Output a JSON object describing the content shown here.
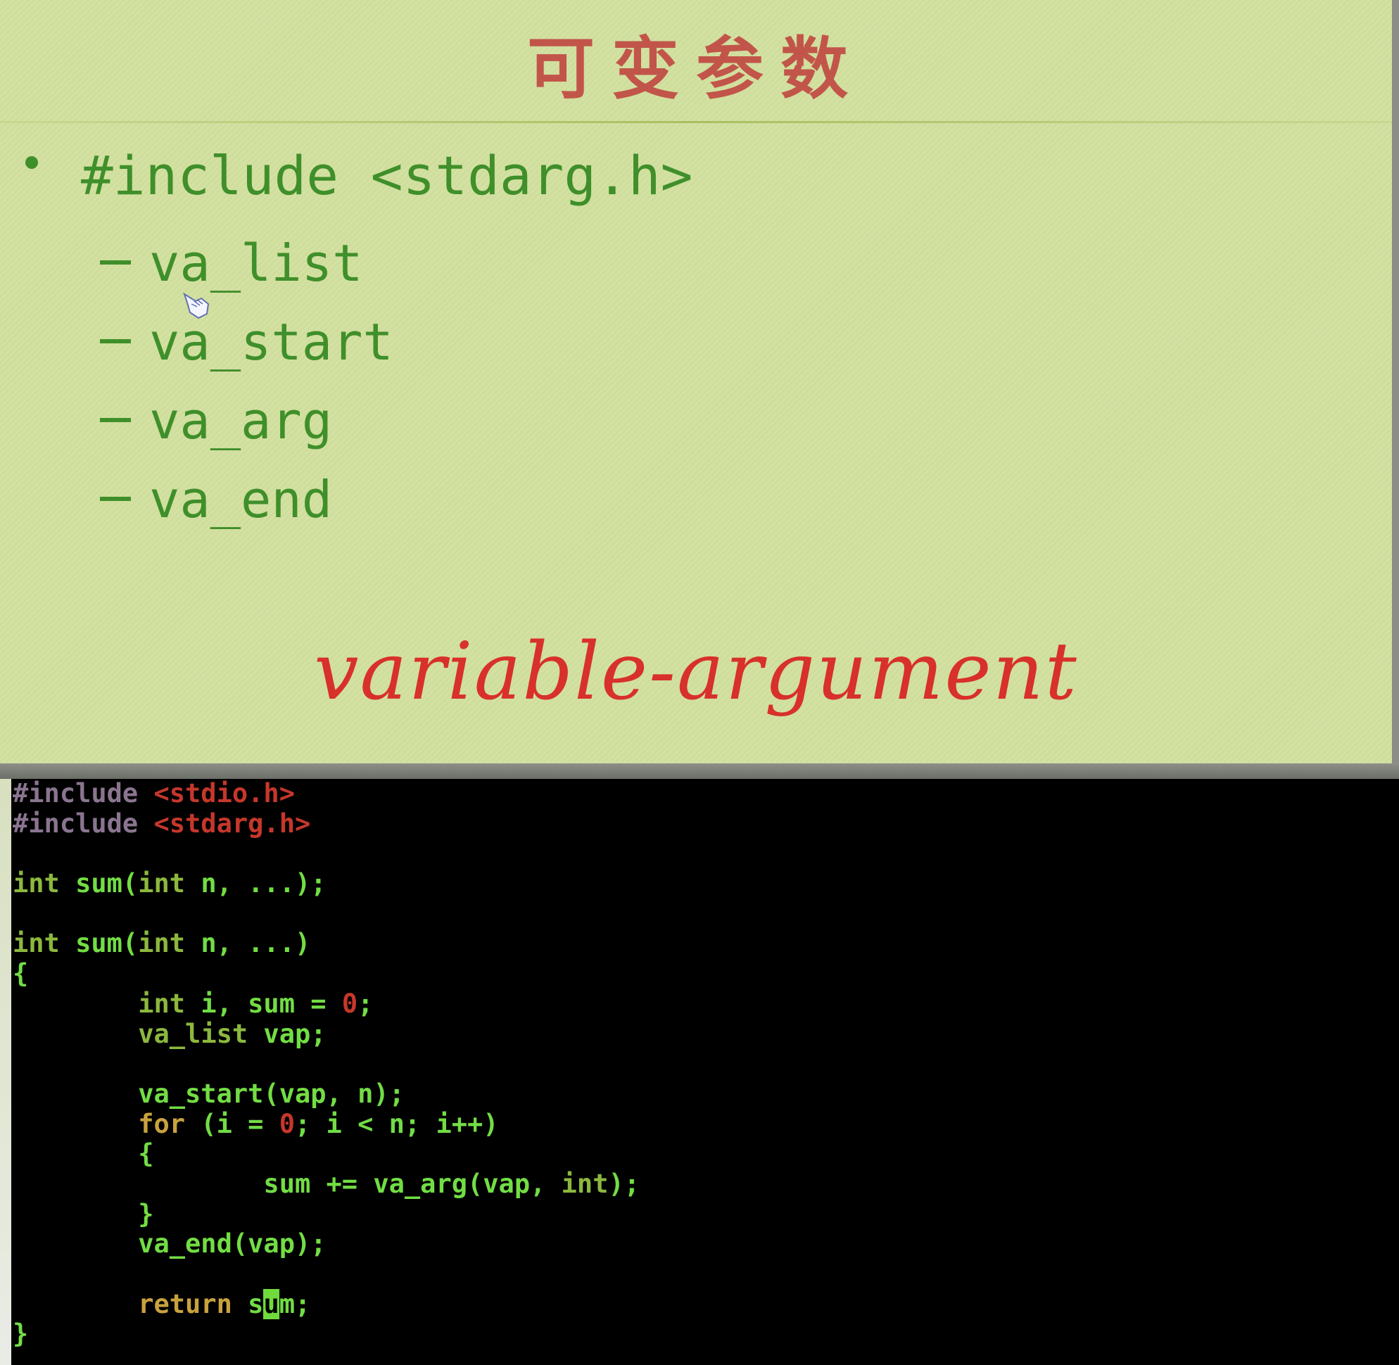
{
  "slide": {
    "title": "可变参数",
    "bullet": "#include <stdarg.h>",
    "sub_items": [
      "va_list",
      "va_start",
      "va_arg",
      "va_end"
    ],
    "handwritten_note": "variable-argument"
  },
  "colors": {
    "preproc": "#8a7590",
    "string": "#c6372b",
    "type": "#8cb83e",
    "ident": "#72dd44",
    "keyword": "#c9a23e",
    "number": "#c6372b"
  },
  "code": {
    "lines": [
      [
        {
          "t": "#include ",
          "c": "preproc"
        },
        {
          "t": "<stdio.h>",
          "c": "string"
        }
      ],
      [
        {
          "t": "#include ",
          "c": "preproc"
        },
        {
          "t": "<stdarg.h>",
          "c": "string"
        }
      ],
      [],
      [
        {
          "t": "int",
          "c": "type"
        },
        {
          "t": " sum(",
          "c": "ident"
        },
        {
          "t": "int",
          "c": "type"
        },
        {
          "t": " n, ...);",
          "c": "ident"
        }
      ],
      [],
      [
        {
          "t": "int",
          "c": "type"
        },
        {
          "t": " sum(",
          "c": "ident"
        },
        {
          "t": "int",
          "c": "type"
        },
        {
          "t": " n, ...)",
          "c": "ident"
        }
      ],
      [
        {
          "t": "{",
          "c": "ident"
        }
      ],
      [
        {
          "t": "        "
        },
        {
          "t": "int",
          "c": "type"
        },
        {
          "t": " i, sum = ",
          "c": "ident"
        },
        {
          "t": "0",
          "c": "number"
        },
        {
          "t": ";",
          "c": "ident"
        }
      ],
      [
        {
          "t": "        "
        },
        {
          "t": "va_list",
          "c": "type"
        },
        {
          "t": " vap;",
          "c": "ident"
        }
      ],
      [],
      [
        {
          "t": "        va_start(vap, n);",
          "c": "ident"
        }
      ],
      [
        {
          "t": "        "
        },
        {
          "t": "for",
          "c": "keyword"
        },
        {
          "t": " (i = ",
          "c": "ident"
        },
        {
          "t": "0",
          "c": "number"
        },
        {
          "t": "; i < n; i++)",
          "c": "ident"
        }
      ],
      [
        {
          "t": "        {",
          "c": "ident"
        }
      ],
      [
        {
          "t": "                sum += va_arg(vap, ",
          "c": "ident"
        },
        {
          "t": "int",
          "c": "type"
        },
        {
          "t": ");",
          "c": "ident"
        }
      ],
      [
        {
          "t": "        }",
          "c": "ident"
        }
      ],
      [
        {
          "t": "        va_end(vap);",
          "c": "ident"
        }
      ],
      [],
      [
        {
          "t": "        "
        },
        {
          "t": "return",
          "c": "keyword"
        },
        {
          "t": " s",
          "c": "ident"
        },
        {
          "t": "u",
          "c": "cursor"
        },
        {
          "t": "m;",
          "c": "ident"
        }
      ],
      [
        {
          "t": "}",
          "c": "ident"
        }
      ]
    ]
  }
}
